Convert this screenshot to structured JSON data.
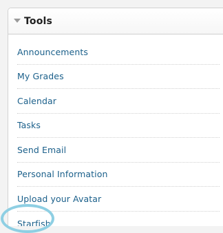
{
  "panel": {
    "title": "Tools",
    "items": [
      {
        "label": "Announcements"
      },
      {
        "label": "My Grades"
      },
      {
        "label": "Calendar"
      },
      {
        "label": "Tasks"
      },
      {
        "label": "Send Email"
      },
      {
        "label": "Personal Information"
      },
      {
        "label": "Upload your Avatar"
      },
      {
        "label": "Starfish"
      }
    ]
  },
  "colors": {
    "link": "#1a5f8a",
    "highlight_ring": "#8ecfe3",
    "header_text": "#1f1f1f"
  },
  "icons": {
    "collapse": "triangle-down-icon"
  }
}
